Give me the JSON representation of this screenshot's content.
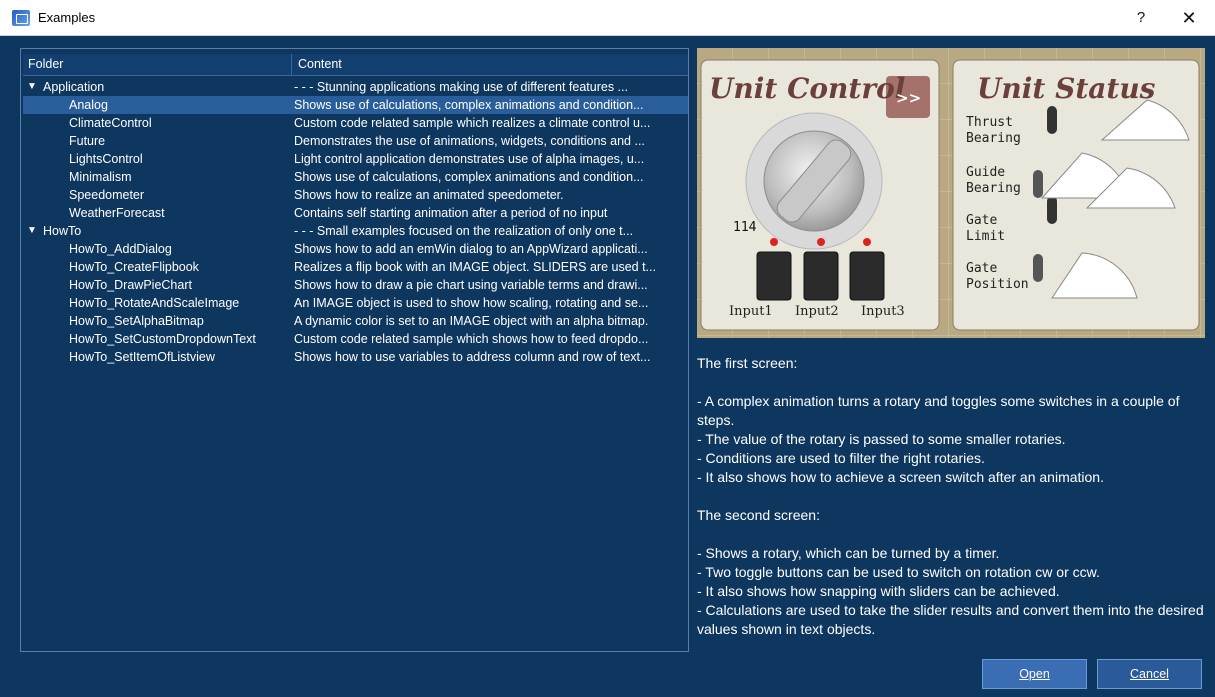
{
  "window": {
    "title": "Examples",
    "help": "?",
    "close": "✕"
  },
  "tree": {
    "columns": [
      "Folder",
      "Content"
    ],
    "rows": [
      {
        "folder": "Application",
        "content": "- - -  Stunning applications making use of different features  ...",
        "group": true,
        "expander": "▼"
      },
      {
        "folder": "Analog",
        "content": "Shows use of calculations, complex animations and condition...",
        "selected": true
      },
      {
        "folder": "ClimateControl",
        "content": "Custom code related sample which realizes a climate control u..."
      },
      {
        "folder": "Future",
        "content": "Demonstrates the use of animations, widgets, conditions and ..."
      },
      {
        "folder": "LightsControl",
        "content": "Light control application demonstrates use of alpha images, u..."
      },
      {
        "folder": "Minimalism",
        "content": "Shows use of calculations, complex animations and condition..."
      },
      {
        "folder": "Speedometer",
        "content": "Shows how to realize an animated speedometer."
      },
      {
        "folder": "WeatherForecast",
        "content": "Contains self starting animation after a period of no input"
      },
      {
        "folder": "HowTo",
        "content": "- - -  Small examples focused on the realization of only one t...",
        "group": true,
        "expander": "▼"
      },
      {
        "folder": "HowTo_AddDialog",
        "content": "Shows how to add an emWin dialog to an AppWizard applicati..."
      },
      {
        "folder": "HowTo_CreateFlipbook",
        "content": "Realizes a flip book with an IMAGE object. SLIDERS are used t..."
      },
      {
        "folder": "HowTo_DrawPieChart",
        "content": "Shows how to draw a pie chart using variable terms and drawi..."
      },
      {
        "folder": "HowTo_RotateAndScaleImage",
        "content": "An IMAGE object is used to show how scaling, rotating and se..."
      },
      {
        "folder": "HowTo_SetAlphaBitmap",
        "content": "A dynamic color is set to an IMAGE object with an alpha bitmap."
      },
      {
        "folder": "HowTo_SetCustomDropdownText",
        "content": "Custom code related sample which shows how to feed dropdo..."
      },
      {
        "folder": "HowTo_SetItemOfListview",
        "content": "Shows how to use variables to address column and row of text..."
      }
    ]
  },
  "preview": {
    "unit_control": {
      "title": "Unit Control",
      "next": ">>",
      "value": "114",
      "inputs": [
        "Input1",
        "Input2",
        "Input3"
      ]
    },
    "unit_status": {
      "title": "Unit Status",
      "labels": [
        [
          "Thrust",
          "Bearing"
        ],
        [
          "Guide",
          "Bearing"
        ],
        [
          "Gate",
          "Limit"
        ],
        [
          "Gate",
          "Position"
        ]
      ]
    }
  },
  "description": [
    "The first screen:",
    "",
    "- A complex animation turns a rotary and toggles some switches in a couple of steps.",
    "- The value of the rotary is passed to some smaller rotaries.",
    "- Conditions are used to filter the right rotaries.",
    "- It also shows how to achieve a screen switch after an animation.",
    "",
    "The second screen:",
    "",
    "- Shows a rotary, which can be turned by a timer.",
    "- Two toggle buttons can be used to switch on rotation cw or ccw.",
    "- It also shows how snapping with sliders can be achieved.",
    "- Calculations are used to take the slider results and convert them into the desired values shown in text objects."
  ],
  "buttons": {
    "open": "Open",
    "cancel": "Cancel"
  },
  "colors": {
    "background": "#0e3760",
    "selected_row": "#2a5e9a",
    "accent_button": "#3b6db4"
  }
}
